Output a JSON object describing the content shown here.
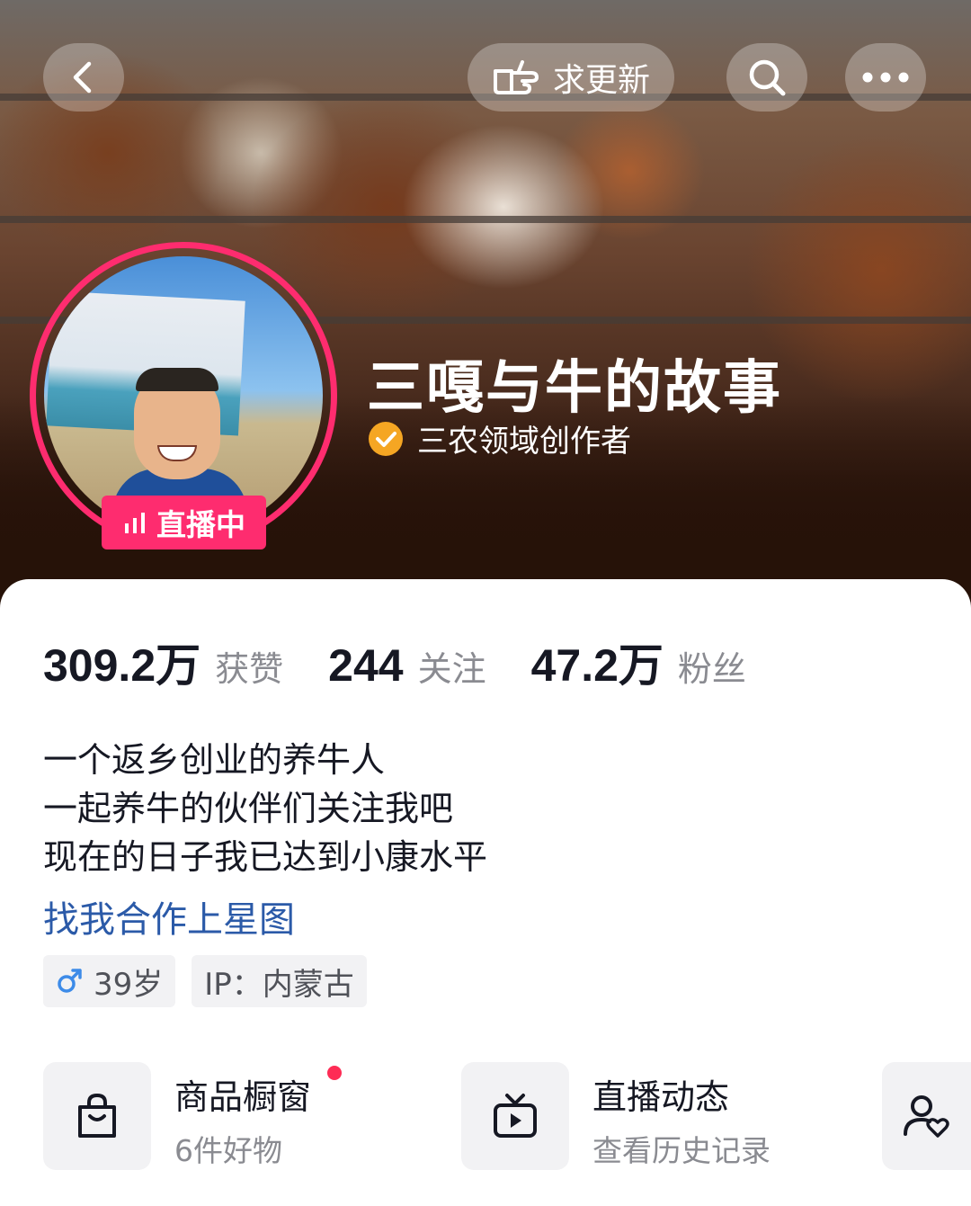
{
  "header": {
    "back_icon": "chevron-left-icon",
    "update_label": "求更新",
    "update_icon": "pointing-hand-icon",
    "search_icon": "search-icon",
    "more_icon": "more-dots-icon"
  },
  "profile": {
    "name": "三嘎与牛的故事",
    "verified_label": "三农领域创作者",
    "verified_color": "#f5a623",
    "live_label": "直播中",
    "accent_color": "#fe2c6f"
  },
  "stats": [
    {
      "value": "309.2万",
      "label": "获赞"
    },
    {
      "value": "244",
      "label": "关注"
    },
    {
      "value": "47.2万",
      "label": "粉丝"
    }
  ],
  "bio": [
    "一个返乡创业的养牛人",
    "一起养牛的伙伴们关注我吧",
    "现在的日子我已达到小康水平"
  ],
  "link": {
    "label": "找我合作上星图",
    "color": "#2b5aa8"
  },
  "tags": {
    "age": "39岁",
    "age_icon": "male-icon",
    "ip": "IP：内蒙古"
  },
  "tiles": [
    {
      "title": "商品橱窗",
      "subtitle": "6件好物",
      "icon": "shopping-bag-icon",
      "has_dot": true
    },
    {
      "title": "直播动态",
      "subtitle": "查看历史记录",
      "icon": "tv-play-icon",
      "has_dot": false
    }
  ],
  "partial_tile_icon": "user-heart-icon"
}
